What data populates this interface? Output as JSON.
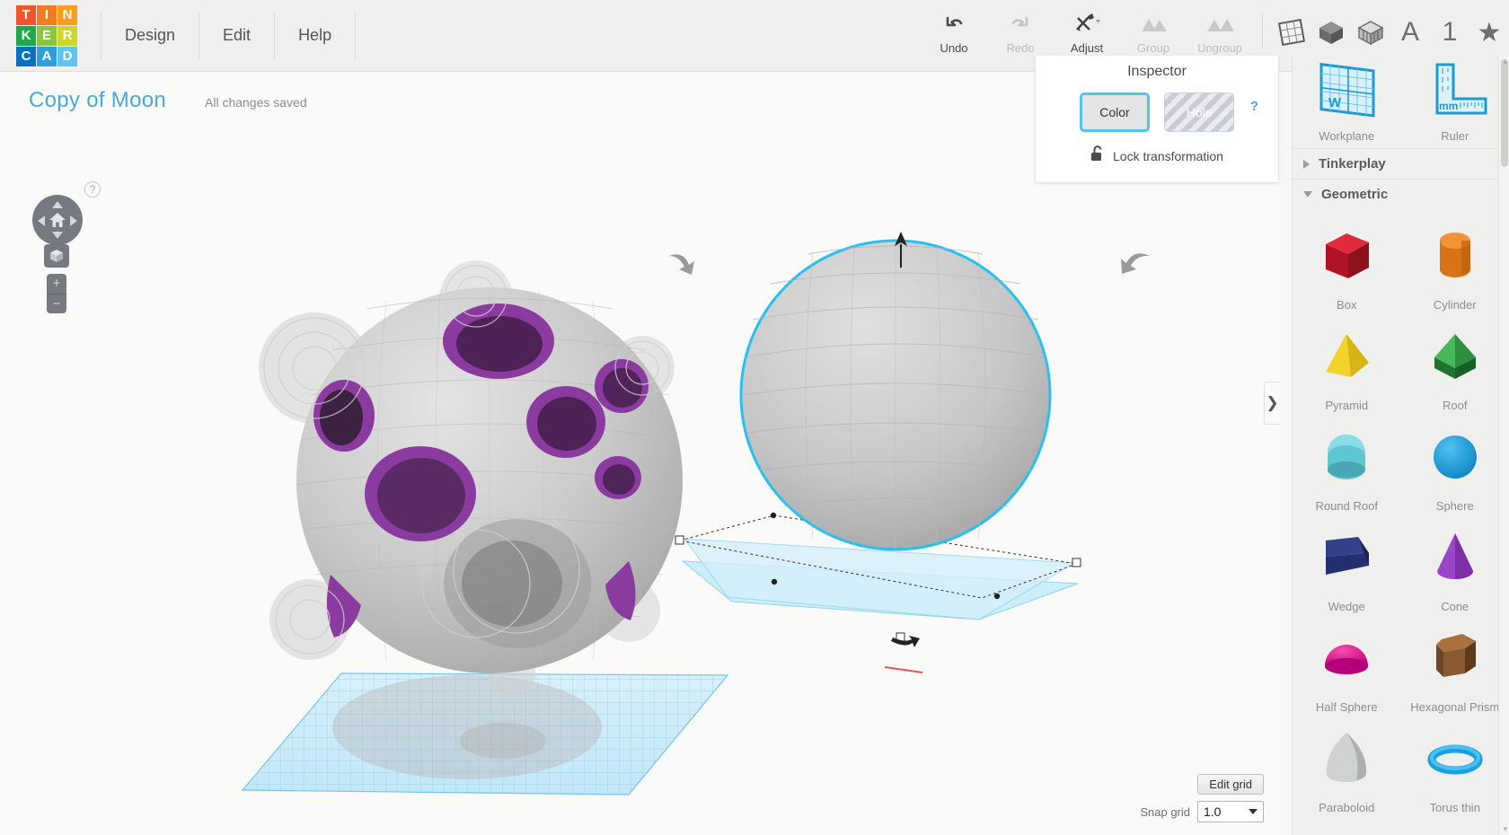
{
  "app": {
    "logo_letters": [
      {
        "ch": "T",
        "color": "#f4532b"
      },
      {
        "ch": "I",
        "color": "#f47b20"
      },
      {
        "ch": "N",
        "color": "#f99f1c"
      },
      {
        "ch": "K",
        "color": "#21a84b"
      },
      {
        "ch": "E",
        "color": "#8cc63e"
      },
      {
        "ch": "R",
        "color": "#cfd62b"
      },
      {
        "ch": "C",
        "color": "#0071bc"
      },
      {
        "ch": "A",
        "color": "#2e9fd9"
      },
      {
        "ch": "D",
        "color": "#5ec5ee"
      }
    ],
    "menu": [
      "Design",
      "Edit",
      "Help"
    ]
  },
  "toolbar": {
    "tools": [
      {
        "label": "Undo",
        "icon": "undo-arrow-icon",
        "disabled": false
      },
      {
        "label": "Redo",
        "icon": "redo-arrow-icon",
        "disabled": true
      },
      {
        "label": "Adjust",
        "icon": "adjust-tools-icon",
        "disabled": false,
        "dropdown": true
      },
      {
        "label": "Group",
        "icon": "group-mountains-icon",
        "disabled": true
      },
      {
        "label": "Ungroup",
        "icon": "ungroup-mountains-icon",
        "disabled": true
      }
    ],
    "icon_buttons": [
      {
        "name": "grid-view-icon",
        "glyph": ""
      },
      {
        "name": "solid-cube-icon",
        "glyph": ""
      },
      {
        "name": "wireframe-cube-icon",
        "glyph": ""
      },
      {
        "name": "text-a-icon",
        "glyph": "A"
      },
      {
        "name": "number-one-icon",
        "glyph": "1"
      },
      {
        "name": "star-favorite-icon",
        "glyph": "★"
      }
    ]
  },
  "document": {
    "title": "Copy of Moon",
    "status": "All changes saved"
  },
  "viewcube": {
    "help_glyph": "?",
    "zoom_in": "+",
    "zoom_out": "−"
  },
  "grid_controls": {
    "edit_grid_label": "Edit grid",
    "snap_grid_label": "Snap grid",
    "snap_grid_value": "1.0"
  },
  "panel_toggle": {
    "glyph": "❯"
  },
  "inspector": {
    "title": "Inspector",
    "color_label": "Color",
    "hole_label": "Hole",
    "lock_label": "Lock transformation",
    "help_glyph": "?",
    "selected": "Color",
    "accent_color": "#54c4e8"
  },
  "sidebar": {
    "top_tools": [
      {
        "label": "Workplane",
        "icon": "workplane-grid-icon",
        "badge": "W"
      },
      {
        "label": "Ruler",
        "icon": "ruler-mm-icon",
        "badge": "mm"
      }
    ],
    "sections": [
      {
        "name": "Tinkerplay",
        "expanded": false
      },
      {
        "name": "Geometric",
        "expanded": true
      }
    ],
    "shapes": [
      {
        "label": "Box",
        "icon": "box-shape-icon",
        "color": "#c1182c"
      },
      {
        "label": "Cylinder",
        "icon": "cylinder-shape-icon",
        "color": "#e07b20"
      },
      {
        "label": "Pyramid",
        "icon": "pyramid-shape-icon",
        "color": "#ead220"
      },
      {
        "label": "Roof",
        "icon": "roof-shape-icon",
        "color": "#2fa34a"
      },
      {
        "label": "Round Roof",
        "icon": "round-roof-shape-icon",
        "color": "#5fc0cd"
      },
      {
        "label": "Sphere",
        "icon": "sphere-shape-icon",
        "color": "#1b9fe0"
      },
      {
        "label": "Wedge",
        "icon": "wedge-shape-icon",
        "color": "#27347a"
      },
      {
        "label": "Cone",
        "icon": "cone-shape-icon",
        "color": "#8d3fbf"
      },
      {
        "label": "Half Sphere",
        "icon": "half-sphere-shape-icon",
        "color": "#e30d8a"
      },
      {
        "label": "Hexagonal Prism",
        "icon": "hexagonal-prism-shape-icon",
        "color": "#8a5a33"
      },
      {
        "label": "Paraboloid",
        "icon": "paraboloid-shape-icon",
        "color": "#c9cbc9"
      },
      {
        "label": "Torus thin",
        "icon": "torus-thin-shape-icon",
        "color": "#1b9fe0"
      }
    ]
  },
  "scene": {
    "object_left_name": "clustered-crater-moon-model",
    "object_right_name": "selected-sphere-model",
    "selection_outline_color": "#29c0f0",
    "workplane_color": "#cdeefb",
    "crater_color": "#7b2d8e",
    "body_color": "#c8c8c8"
  }
}
